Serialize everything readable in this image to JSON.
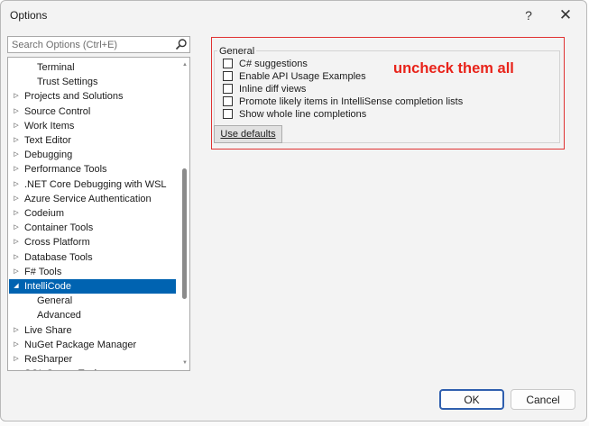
{
  "window": {
    "title": "Options",
    "help_label": "?",
    "close_label": "✕"
  },
  "search": {
    "placeholder": "Search Options (Ctrl+E)"
  },
  "tree": {
    "items": [
      {
        "label": "Terminal",
        "expander": "",
        "level": 1,
        "selected": false
      },
      {
        "label": "Trust Settings",
        "expander": "",
        "level": 1,
        "selected": false
      },
      {
        "label": "Projects and Solutions",
        "expander": "▷",
        "level": 0,
        "selected": false
      },
      {
        "label": "Source Control",
        "expander": "▷",
        "level": 0,
        "selected": false
      },
      {
        "label": "Work Items",
        "expander": "▷",
        "level": 0,
        "selected": false
      },
      {
        "label": "Text Editor",
        "expander": "▷",
        "level": 0,
        "selected": false
      },
      {
        "label": "Debugging",
        "expander": "▷",
        "level": 0,
        "selected": false
      },
      {
        "label": "Performance Tools",
        "expander": "▷",
        "level": 0,
        "selected": false
      },
      {
        "label": ".NET Core Debugging with WSL",
        "expander": "▷",
        "level": 0,
        "selected": false
      },
      {
        "label": "Azure Service Authentication",
        "expander": "▷",
        "level": 0,
        "selected": false
      },
      {
        "label": "Codeium",
        "expander": "▷",
        "level": 0,
        "selected": false
      },
      {
        "label": "Container Tools",
        "expander": "▷",
        "level": 0,
        "selected": false
      },
      {
        "label": "Cross Platform",
        "expander": "▷",
        "level": 0,
        "selected": false
      },
      {
        "label": "Database Tools",
        "expander": "▷",
        "level": 0,
        "selected": false
      },
      {
        "label": "F# Tools",
        "expander": "▷",
        "level": 0,
        "selected": false
      },
      {
        "label": "IntelliCode",
        "expander": "◢",
        "level": 0,
        "selected": true
      },
      {
        "label": "General",
        "expander": "",
        "level": 1,
        "selected": false
      },
      {
        "label": "Advanced",
        "expander": "",
        "level": 1,
        "selected": false
      },
      {
        "label": "Live Share",
        "expander": "▷",
        "level": 0,
        "selected": false
      },
      {
        "label": "NuGet Package Manager",
        "expander": "▷",
        "level": 0,
        "selected": false
      },
      {
        "label": "ReSharper",
        "expander": "▷",
        "level": 0,
        "selected": false
      },
      {
        "label": "SQL Server Tools",
        "expander": "▷",
        "level": 0,
        "selected": false
      }
    ]
  },
  "general": {
    "title": "General",
    "options": [
      {
        "label": "C# suggestions",
        "checked": false
      },
      {
        "label": "Enable API Usage Examples",
        "checked": false
      },
      {
        "label": "Inline diff views",
        "checked": false
      },
      {
        "label": "Promote likely items in IntelliSense completion lists",
        "checked": false
      },
      {
        "label": "Show whole line completions",
        "checked": false
      }
    ],
    "use_defaults_label": "Use defaults"
  },
  "annotation": {
    "text": "uncheck them all",
    "color": "#e8231a"
  },
  "footer": {
    "ok_label": "OK",
    "cancel_label": "Cancel"
  },
  "colors": {
    "selection": "#0063b1",
    "accent_border": "#2f5fae"
  }
}
